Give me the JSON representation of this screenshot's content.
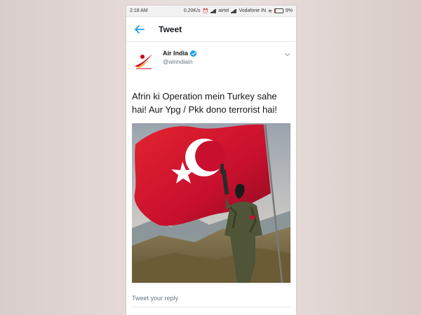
{
  "status_bar": {
    "time": "2:18 AM",
    "speed": "0.20K/s",
    "carrier1": "airtel",
    "carrier2": "Vodafone IN",
    "battery": "9%"
  },
  "header": {
    "title": "Tweet",
    "back_icon": "arrow-left-icon"
  },
  "tweet": {
    "author_name": "Air India",
    "handle": "@airindiain",
    "verified": true,
    "text": "Afrin ki Operation mein Turkey sahe hai! Aur Ypg / Pkk dono terrorist hai!",
    "media": "photo"
  },
  "reply": {
    "placeholder": "Tweet your reply"
  },
  "colors": {
    "accent": "#1da1f2",
    "flag_red": "#c8102e"
  }
}
